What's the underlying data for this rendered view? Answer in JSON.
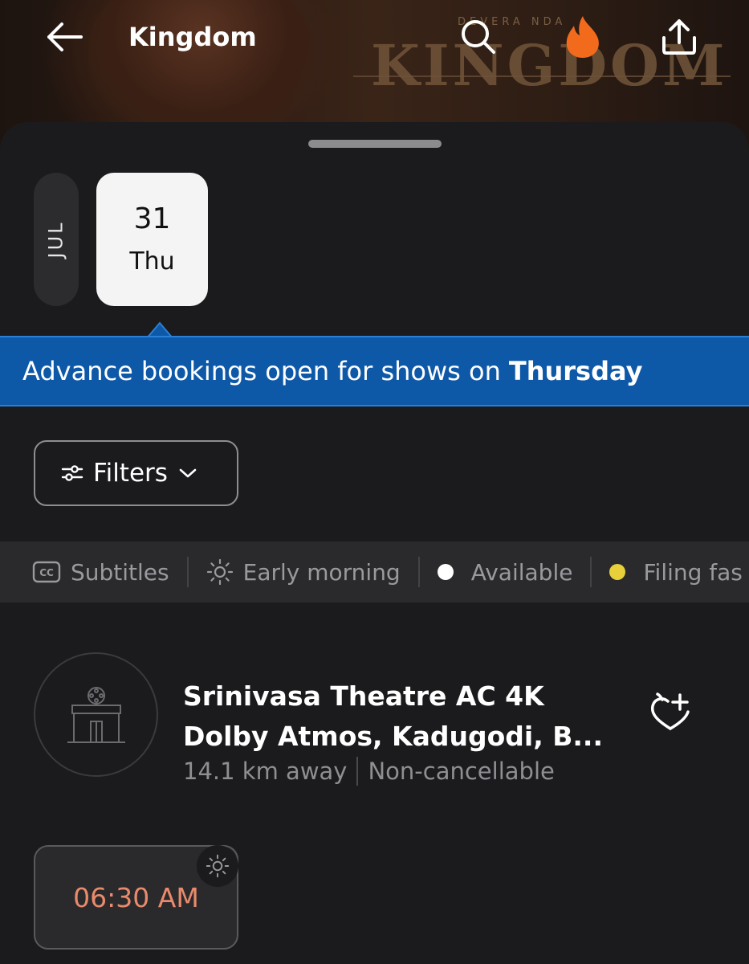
{
  "header": {
    "title": "Kingdom",
    "hero_logo_text": "KINGDOM",
    "hero_small_text": "DEVERA  NDA"
  },
  "date_picker": {
    "month": "JUL",
    "selected": {
      "day_number": "31",
      "weekday": "Thu"
    }
  },
  "banner": {
    "text": "Advance bookings open for shows on",
    "highlight": "Thursday"
  },
  "filters": {
    "label": "Filters"
  },
  "legend": {
    "items": [
      {
        "label": "Subtitles",
        "icon": "cc-icon"
      },
      {
        "label": "Early morning",
        "icon": "sun-icon"
      },
      {
        "label": "Available",
        "icon": "dot",
        "color": "#ffffff"
      },
      {
        "label": "Filing fas",
        "icon": "dot",
        "color": "#e8d03a"
      }
    ]
  },
  "theatre": {
    "name": "Srinivasa Theatre AC 4K Dolby Atmos, Kadugodi, B...",
    "distance": "14.1 km away",
    "policy": "Non-cancellable"
  },
  "showtimes": [
    {
      "time": "06:30 AM",
      "color": "#e98a6c"
    }
  ],
  "colors": {
    "banner_bg": "#0e58a8",
    "fire_icon": "#f26a1b",
    "showtime_text": "#e98a6c"
  }
}
